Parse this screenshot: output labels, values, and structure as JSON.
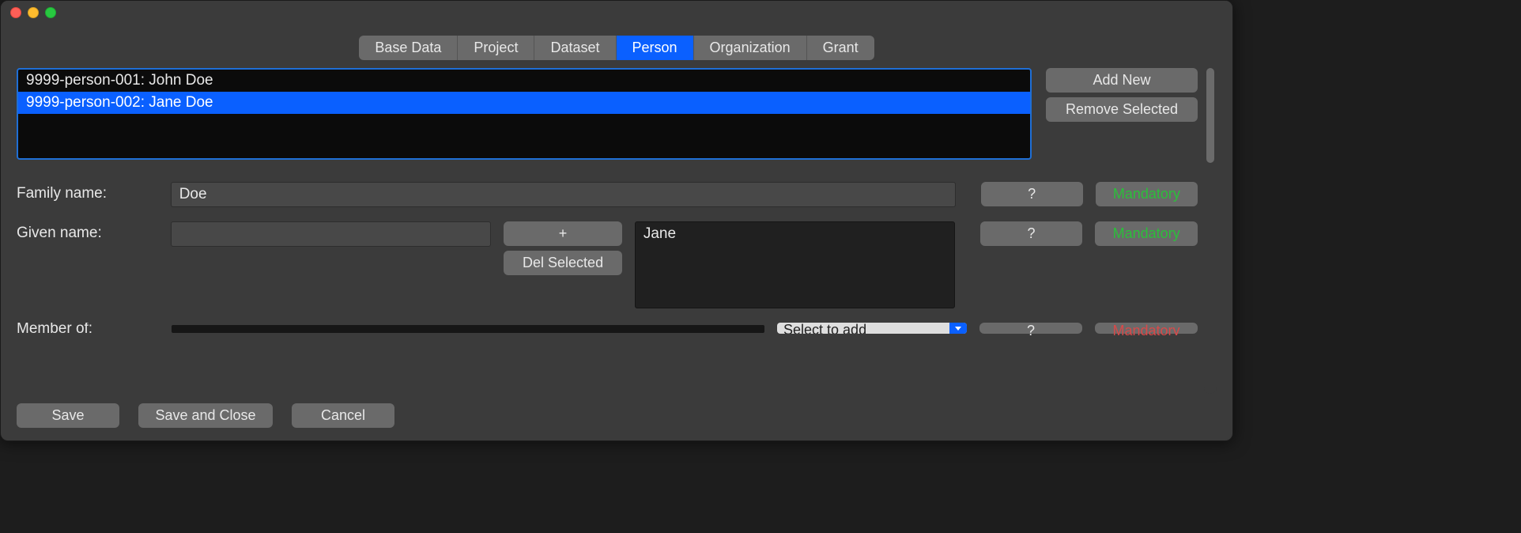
{
  "tabs": {
    "items": [
      {
        "label": "Base Data"
      },
      {
        "label": "Project"
      },
      {
        "label": "Dataset"
      },
      {
        "label": "Person"
      },
      {
        "label": "Organization"
      },
      {
        "label": "Grant"
      }
    ],
    "active_index": 3
  },
  "list": {
    "items": [
      {
        "label": "9999-person-001: John Doe"
      },
      {
        "label": "9999-person-002: Jane Doe"
      }
    ],
    "selected_index": 1
  },
  "list_buttons": {
    "add": "Add New",
    "remove": "Remove Selected"
  },
  "form": {
    "family_name": {
      "label": "Family name:",
      "value": "Doe",
      "help": "?",
      "status": "Mandatory"
    },
    "given_name": {
      "label": "Given name:",
      "input_value": "",
      "add": "+",
      "del": "Del Selected",
      "list_value": "Jane",
      "help": "?",
      "status": "Mandatory"
    },
    "member_of": {
      "label": "Member of:",
      "select_placeholder": "Select to add",
      "help": "?",
      "status": "Mandatory"
    }
  },
  "footer": {
    "save": "Save",
    "save_close": "Save and Close",
    "cancel": "Cancel"
  }
}
